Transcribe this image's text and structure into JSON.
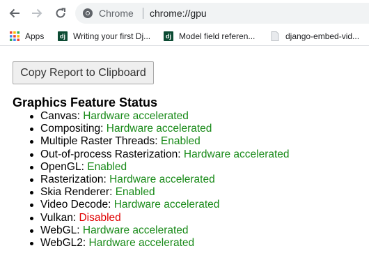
{
  "toolbar": {
    "back_icon": "arrow-left-icon",
    "forward_icon": "arrow-right-icon",
    "reload_icon": "reload-icon",
    "site_chip": "Chrome",
    "url": "chrome://gpu"
  },
  "bookmarks": [
    {
      "label": "Apps",
      "icon": "apps-grid-icon"
    },
    {
      "label": "Writing your first Dj...",
      "icon": "django-icon"
    },
    {
      "label": "Model field referen...",
      "icon": "django-icon"
    },
    {
      "label": "django-embed-vid...",
      "icon": "page-icon"
    }
  ],
  "page": {
    "copy_button_label": "Copy Report to Clipboard",
    "section_title": "Graphics Feature Status",
    "features": [
      {
        "name": "Canvas",
        "status": "Hardware accelerated",
        "status_color": "#188a18"
      },
      {
        "name": "Compositing",
        "status": "Hardware accelerated",
        "status_color": "#188a18"
      },
      {
        "name": "Multiple Raster Threads",
        "status": "Enabled",
        "status_color": "#188a18"
      },
      {
        "name": "Out-of-process Rasterization",
        "status": "Hardware accelerated",
        "status_color": "#188a18"
      },
      {
        "name": "OpenGL",
        "status": "Enabled",
        "status_color": "#188a18"
      },
      {
        "name": "Rasterization",
        "status": "Hardware accelerated",
        "status_color": "#188a18"
      },
      {
        "name": "Skia Renderer",
        "status": "Enabled",
        "status_color": "#188a18"
      },
      {
        "name": "Video Decode",
        "status": "Hardware accelerated",
        "status_color": "#188a18"
      },
      {
        "name": "Vulkan",
        "status": "Disabled",
        "status_color": "#e00000"
      },
      {
        "name": "WebGL",
        "status": "Hardware accelerated",
        "status_color": "#188a18"
      },
      {
        "name": "WebGL2",
        "status": "Hardware accelerated",
        "status_color": "#188a18"
      }
    ]
  }
}
